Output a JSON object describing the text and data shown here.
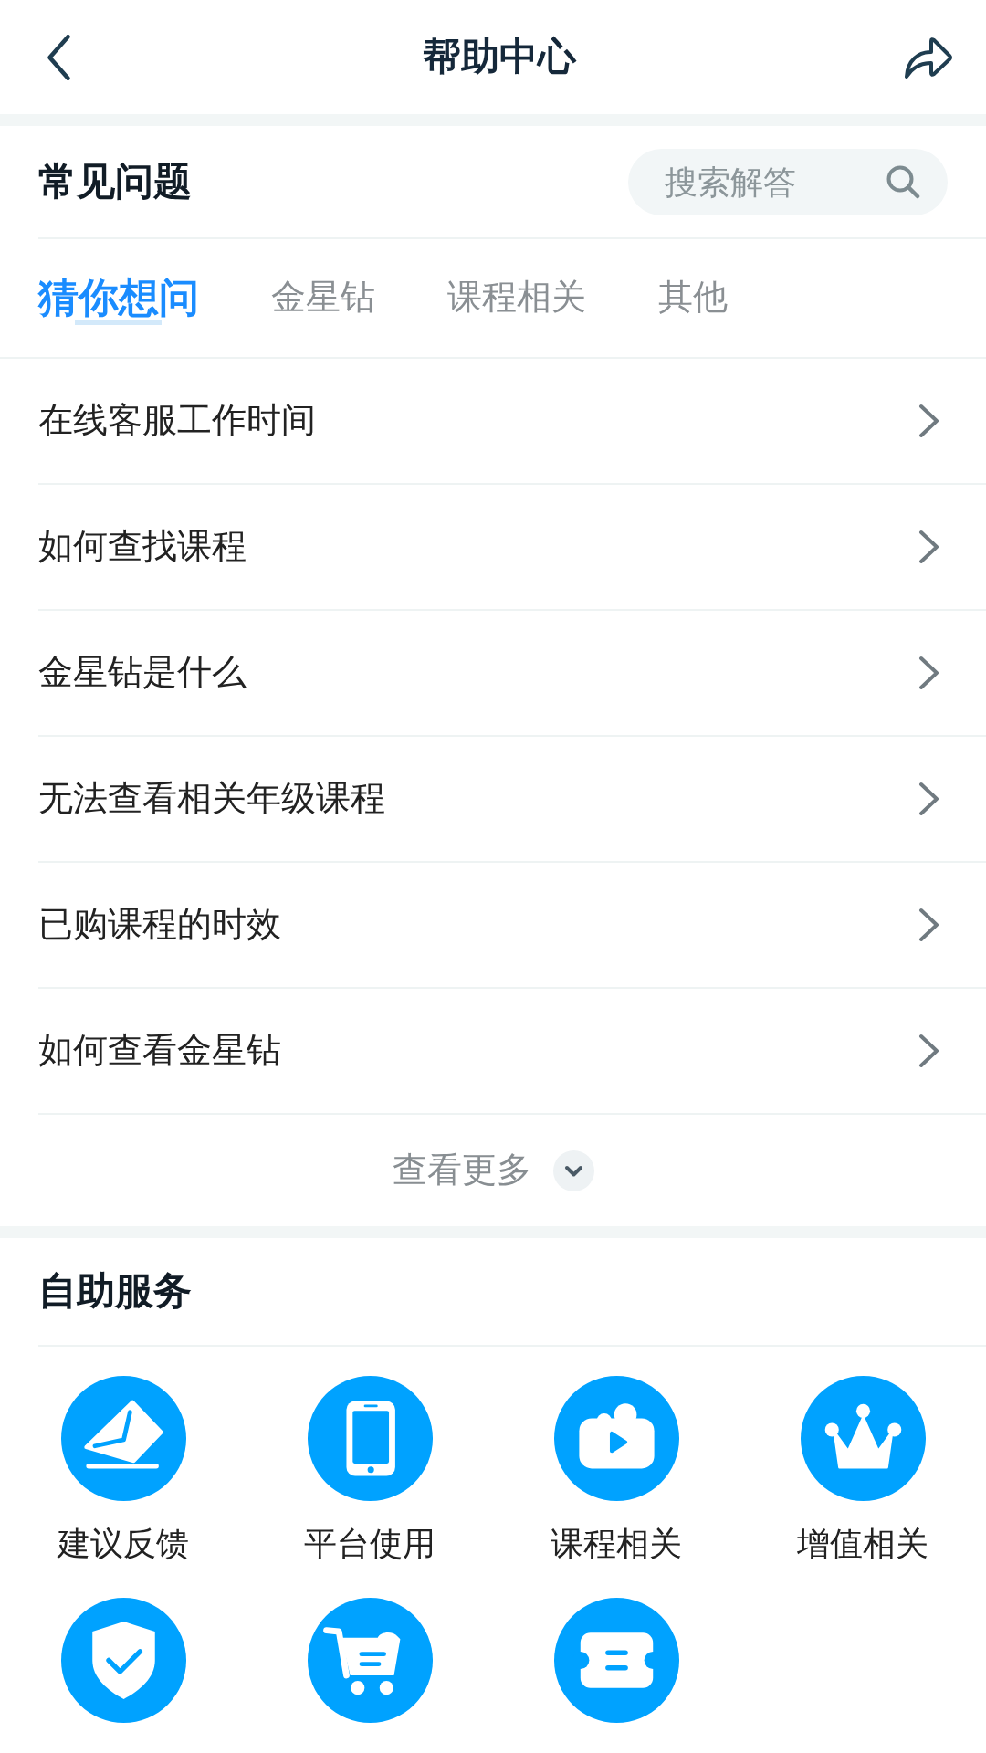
{
  "header": {
    "title": "帮助中心"
  },
  "faq": {
    "title": "常见问题",
    "search": {
      "placeholder": "搜索解答"
    },
    "tabs": [
      {
        "label": "猜你想问",
        "selected": true
      },
      {
        "label": "金星钻",
        "selected": false
      },
      {
        "label": "课程相关",
        "selected": false
      },
      {
        "label": "其他",
        "selected": false
      }
    ],
    "questions": [
      "在线客服工作时间",
      "如何查找课程",
      "金星钻是什么",
      "无法查看相关年级课程",
      "已购课程的时效",
      "如何查看金星钻"
    ],
    "more": "查看更多"
  },
  "services": {
    "title": "自助服务",
    "items": [
      {
        "kind": "mail",
        "label": "建议反馈"
      },
      {
        "kind": "phone",
        "label": "平台使用"
      },
      {
        "kind": "video",
        "label": "课程相关"
      },
      {
        "kind": "crown",
        "label": "增值相关"
      },
      {
        "kind": "shield"
      },
      {
        "kind": "cart"
      },
      {
        "kind": "ticket"
      }
    ]
  }
}
